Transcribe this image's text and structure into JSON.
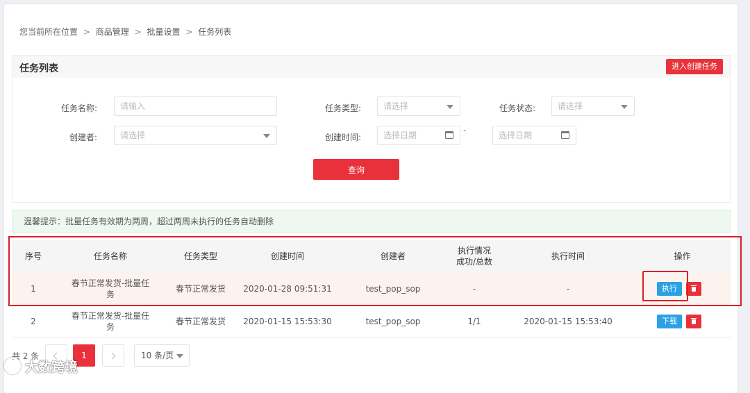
{
  "breadcrumb": {
    "prefix": "您当前所在位置",
    "sep": ">",
    "items": [
      "商品管理",
      "批量设置",
      "任务列表"
    ]
  },
  "section": {
    "title": "任务列表",
    "create_label": "进入创建任务"
  },
  "filters": {
    "task_name": {
      "label": "任务名称:",
      "placeholder": "请输入"
    },
    "task_type": {
      "label": "任务类型:",
      "placeholder": "请选择"
    },
    "task_status": {
      "label": "任务状态:",
      "placeholder": "请选择"
    },
    "creator": {
      "label": "创建者:",
      "placeholder": "请选择"
    },
    "create_time": {
      "label": "创建时间:",
      "start_placeholder": "选择日期",
      "end_placeholder": "选择日期",
      "range_sep": "-"
    },
    "query_label": "查询"
  },
  "notice": "温馨提示：批量任务有效期为两周，超过两周未执行的任务自动删除",
  "table": {
    "headers": [
      "序号",
      "任务名称",
      "任务类型",
      "创建时间",
      "创建者",
      "执行情况\n成功/总数",
      "执行时间",
      "操作"
    ],
    "rows": [
      {
        "index": "1",
        "name": "春节正常发货-批量任务",
        "type": "春节正常发货",
        "created": "2020-01-28 09:51:31",
        "creator": "test_pop_sop",
        "result": "-",
        "exec_time": "-",
        "action": "执行"
      },
      {
        "index": "2",
        "name": "春节正常发货-批量任务",
        "type": "春节正常发货",
        "created": "2020-01-15 15:53:30",
        "creator": "test_pop_sop",
        "result": "1/1",
        "exec_time": "2020-01-15 15:53:40",
        "action": "下载"
      }
    ]
  },
  "pagination": {
    "total": "共 2 条",
    "current": "1",
    "page_size": "10 条/页"
  },
  "watermark": "大数跨境",
  "colors": {
    "primary_red": "#e8313a",
    "action_blue": "#2aa1e4",
    "highlight": "#d8202a",
    "notice_bg": "#eef8f0"
  }
}
